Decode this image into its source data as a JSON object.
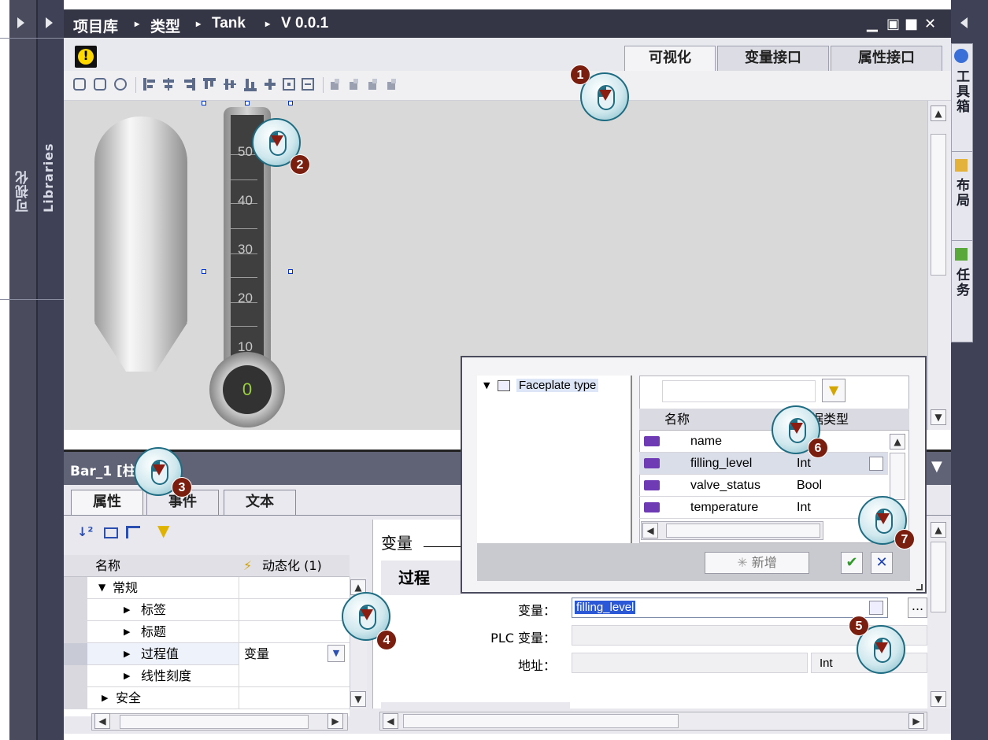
{
  "left_sidebar": {
    "visualization_tab": "可视化",
    "libraries_tab": "Libraries"
  },
  "titlebar": {
    "breadcrumb": [
      "项目库",
      "类型",
      "Tank",
      "V 0.0.1"
    ],
    "separator": "▸"
  },
  "right_sidebar": {
    "tabs": [
      "工具箱",
      "布局",
      "任务"
    ]
  },
  "editor": {
    "warning_glyph": "!",
    "tabs": [
      "可视化",
      "变量接口",
      "属性接口"
    ],
    "active_tab": "可视化"
  },
  "thermometer": {
    "ticks": [
      "50",
      "40",
      "30",
      "20",
      "10"
    ],
    "value": "0"
  },
  "inspector": {
    "title": "Bar_1 [柱",
    "tabs": [
      "属性",
      "事件",
      "文本"
    ],
    "columns": {
      "name": "名称",
      "dynamic": "动态化 (1)"
    },
    "rows": [
      {
        "label": "常规",
        "expand": "▼",
        "value": ""
      },
      {
        "label": "标签",
        "expand": "▶",
        "value": ""
      },
      {
        "label": "标题",
        "expand": "▶",
        "value": ""
      },
      {
        "label": "过程值",
        "expand": "▶",
        "value": "变量"
      },
      {
        "label": "线性刻度",
        "expand": "▶",
        "value": ""
      },
      {
        "label": "安全",
        "expand": "▶",
        "value": ""
      }
    ],
    "form": {
      "heading": "变量",
      "group_title": "过程",
      "variable_label": "变量：",
      "variable_value": "filling_level",
      "plc_label": "PLC 变量：",
      "address_label": "地址：",
      "address_type": "Int",
      "browse_btn": "..."
    }
  },
  "popup": {
    "tree_item": "Faceplate type",
    "header_name": "名称",
    "header_type": "据类型",
    "rows": [
      {
        "name": "name",
        "type": "ing"
      },
      {
        "name": "filling_level",
        "type": "Int"
      },
      {
        "name": "valve_status",
        "type": "Bool"
      },
      {
        "name": "temperature",
        "type": "Int"
      }
    ],
    "add_button": "新增",
    "ok_glyph": "✔",
    "cancel_glyph": "✕"
  },
  "callouts": [
    "1",
    "2",
    "3",
    "4",
    "5",
    "6",
    "7"
  ],
  "colors": {
    "accent_blue": "#2a58d6",
    "callout_number": "#7a1e10",
    "dark_chrome": "#3f4157"
  }
}
